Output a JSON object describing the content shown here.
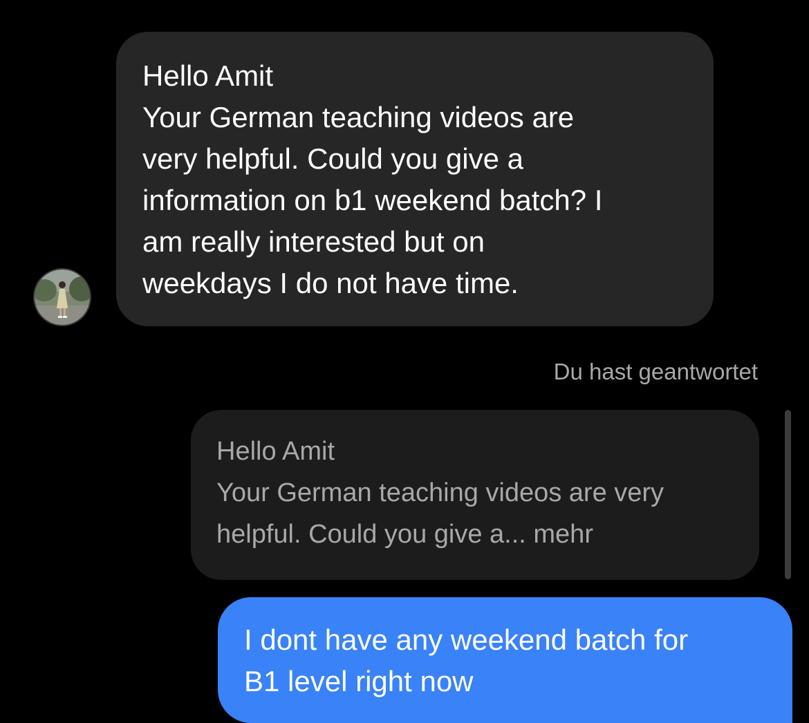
{
  "incoming_message": {
    "lines": [
      "Hello Amit",
      "Your German teaching videos are",
      "very helpful. Could you give a",
      "information on b1 weekend batch?  I",
      "am really interested but on",
      "weekdays I do not have time."
    ]
  },
  "reply_status": "Du hast geantwortet",
  "quoted_message": {
    "title": "Hello Amit",
    "lines": [
      "Your German teaching videos are very",
      "helpful. Could you give a... mehr"
    ]
  },
  "outgoing_message": {
    "lines": [
      "I dont have any weekend batch for",
      "B1 level right now"
    ]
  },
  "colors": {
    "background": "#000000",
    "incoming_bubble": "#262626",
    "quoted_bubble": "#1c1c1c",
    "outgoing_bubble": "#3a82f7",
    "secondary_text": "#a8a8a8"
  }
}
